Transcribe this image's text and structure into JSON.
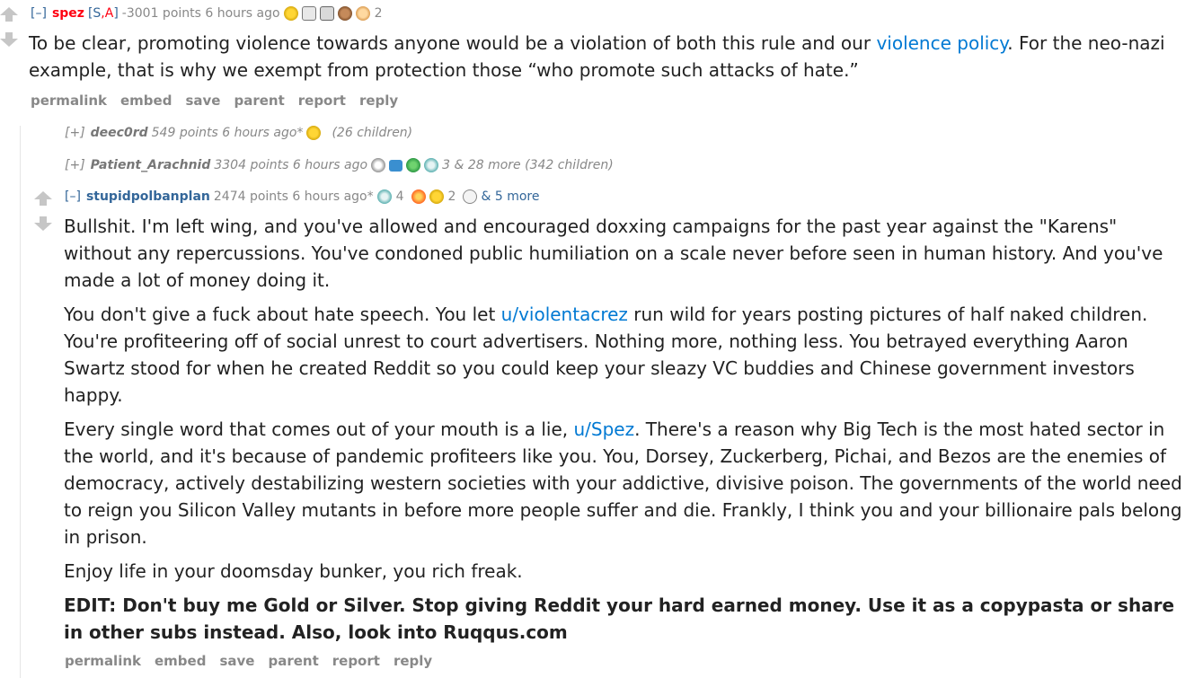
{
  "comment1": {
    "toggle": "[–]",
    "author": "spez",
    "flair_open": "[",
    "flair_s": "S",
    "flair_comma": ",",
    "flair_a": "A",
    "flair_close": "]",
    "points": "-3001 points 6 hours ago",
    "award_count": "2",
    "body": "To be clear, promoting violence towards anyone would be a violation of both this rule and our ",
    "link_text": "violence policy",
    "body_after": ". For the neo-nazi example, that is why we exempt from protection those “who promote such attacks of hate.”",
    "buttons": [
      "permalink",
      "embed",
      "save",
      "parent",
      "report",
      "reply"
    ]
  },
  "comment2": {
    "toggle": "[+]",
    "author": "deec0rd",
    "points": "549 points 6 hours ago*",
    "children": "(26 children)"
  },
  "comment3": {
    "toggle": "[+]",
    "author": "Patient_Arachnid",
    "points": "3304 points 6 hours ago",
    "more": "3 & 28 more (342 children)"
  },
  "comment4": {
    "toggle": "[–]",
    "author": "stupidpolbanplan",
    "points": "2474 points 6 hours ago*",
    "award_count_1": "4",
    "award_count_2": "2",
    "more": "& 5 more",
    "p1": "Bullshit. I'm left wing, and you've allowed and encouraged doxxing campaigns for the past year against the \"Karens\" without any repercussions. You've condoned public humiliation on a scale never before seen in human history. And you've made a lot of money doing it.",
    "p2_before": "You don't give a fuck about hate speech. You let ",
    "p2_link": "u/violentacrez",
    "p2_after": " run wild for years posting pictures of half naked children. You're profiteering off of social unrest to court advertisers. Nothing more, nothing less. You betrayed everything Aaron Swartz stood for when he created Reddit so you could keep your sleazy VC buddies and Chinese government investors happy.",
    "p3_before": "Every single word that comes out of your mouth is a lie, ",
    "p3_link": "u/Spez",
    "p3_after": ". There's a reason why Big Tech is the most hated sector in the world, and it's because of pandemic profiteers like you. You, Dorsey, Zuckerberg, Pichai, and Bezos are the enemies of democracy, actively destabilizing western societies with your addictive, divisive poison. The governments of the world need to reign you Silicon Valley mutants in before more people suffer and die. Frankly, I think you and your billionaire pals belong in prison.",
    "p4": "Enjoy life in your doomsday bunker, you rich freak.",
    "p5": "EDIT: Don't buy me Gold or Silver. Stop giving Reddit your hard earned money. Use it as a copypasta or share in other subs instead. Also, look into Ruqqus.com",
    "buttons": [
      "permalink",
      "embed",
      "save",
      "parent",
      "report",
      "reply"
    ]
  },
  "colors": {
    "link": "#0079d3",
    "author": "#336699",
    "admin": "#ff0011",
    "muted": "#888888"
  }
}
